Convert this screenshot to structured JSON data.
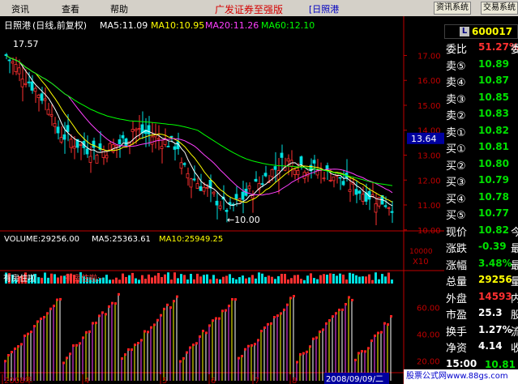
{
  "menu": {
    "items": [
      "资讯",
      "查看",
      "帮助"
    ],
    "brand": "广发证券至强版",
    "stock_tag": "[日照港",
    "buttons": [
      "资讯系统",
      "交易系统"
    ]
  },
  "chart_header": {
    "name": "日照港",
    "period": "(日线,前复权)",
    "ma5": "MA5:11.09",
    "ma10": "MA10:10.95",
    "ma20": "MA20:11.26",
    "ma60": "MA60:12.10",
    "high_label": "17.57",
    "low_label": "10.00",
    "price_marker": "13.64",
    "y_ticks": [
      "17.00",
      "16.00",
      "15.00",
      "14.00",
      "13.00",
      "12.00",
      "11.00",
      "10.00"
    ]
  },
  "volume": {
    "label": "VOLUME:29256.00",
    "ma5": "MA5:25363.61",
    "ma10": "MA10:25949.25",
    "y_ticks": [
      "10000"
    ],
    "scale_tag": "X10"
  },
  "indicator": {
    "name": "有房住啦",
    "sub": "有房住啦:-",
    "y_ticks": [
      "60.00",
      "40.00",
      "20.00"
    ]
  },
  "x_axis": {
    "labels": [
      "2008年",
      "4",
      "5",
      "6",
      "7",
      "8"
    ],
    "cursor_date": "2008/09/09/二"
  },
  "sidebar": {
    "code": "600017",
    "code_badge": "L",
    "webi": {
      "label": "委比",
      "value": "51.27%",
      "cut": "委"
    },
    "asks": [
      {
        "label": "卖⑤",
        "price": "10.89"
      },
      {
        "label": "卖④",
        "price": "10.87"
      },
      {
        "label": "卖③",
        "price": "10.85"
      },
      {
        "label": "卖②",
        "price": "10.83"
      },
      {
        "label": "卖①",
        "price": "10.82"
      }
    ],
    "bids": [
      {
        "label": "买①",
        "price": "10.81"
      },
      {
        "label": "买②",
        "price": "10.80"
      },
      {
        "label": "买③",
        "price": "10.79"
      },
      {
        "label": "买④",
        "price": "10.78"
      },
      {
        "label": "买⑤",
        "price": "10.77"
      }
    ],
    "stats": [
      {
        "label": "现价",
        "value": "10.82",
        "cut": "今"
      },
      {
        "label": "涨跌",
        "value": "-0.39",
        "cut": "最"
      },
      {
        "label": "涨幅",
        "value": "3.48%",
        "cut": "最"
      },
      {
        "label": "总量",
        "value": "29256",
        "cut": "量"
      },
      {
        "label": "外盘",
        "value": "14593",
        "cut": "内"
      },
      {
        "label": "市盈",
        "value": "25.3",
        "cut": "股"
      },
      {
        "label": "换手",
        "value": "1.27%",
        "cut": "流"
      },
      {
        "label": "净资",
        "value": "4.14",
        "cut": "收"
      }
    ],
    "time_row": {
      "time": "15:00",
      "price": "10.81"
    }
  },
  "footer": {
    "site": "股票公式网www.88gs.com"
  },
  "colors": {
    "up": "#ff3030",
    "down": "#00e0e0",
    "ma5": "#ffffff",
    "ma10": "#ffff00",
    "ma20": "#ff40ff",
    "ma60": "#00ff00",
    "axis": "#c00000"
  }
}
